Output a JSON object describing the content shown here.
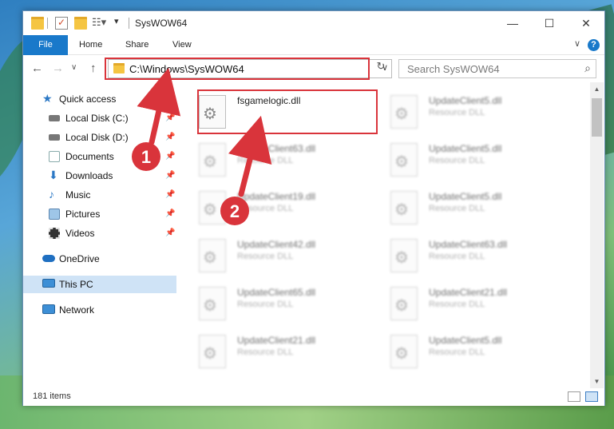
{
  "window": {
    "title": "SysWOW64",
    "minimize_glyph": "—",
    "maximize_glyph": "☐",
    "close_glyph": "✕"
  },
  "ribbon": {
    "tabs": [
      "File",
      "Home",
      "Share",
      "View"
    ],
    "help_glyph": "?",
    "collapse_glyph": "∨"
  },
  "nav": {
    "back_glyph": "←",
    "forward_glyph": "→",
    "recent_glyph": "∨",
    "up_glyph": "↑",
    "address": "C:\\Windows\\SysWOW64",
    "address_drop_glyph": "∨",
    "refresh_glyph": "↻",
    "search_placeholder": "Search SysWOW64",
    "search_glyph": "⌕"
  },
  "sidebar": {
    "items": [
      {
        "label": "Quick access",
        "icon": "star-icon",
        "pinned": false
      },
      {
        "label": "Local Disk (C:)",
        "icon": "drive-icon",
        "pinned": true
      },
      {
        "label": "Local Disk (D:)",
        "icon": "drive-icon",
        "pinned": true
      },
      {
        "label": "Documents",
        "icon": "documents-icon",
        "pinned": true
      },
      {
        "label": "Downloads",
        "icon": "download-icon",
        "pinned": true
      },
      {
        "label": "Music",
        "icon": "music-icon",
        "pinned": true
      },
      {
        "label": "Pictures",
        "icon": "pictures-icon",
        "pinned": true
      },
      {
        "label": "Videos",
        "icon": "videos-icon",
        "pinned": true
      },
      {
        "label": "OneDrive",
        "icon": "cloud-icon",
        "pinned": false
      },
      {
        "label": "This PC",
        "icon": "computer-icon",
        "pinned": false,
        "selected": true
      },
      {
        "label": "Network",
        "icon": "network-icon",
        "pinned": false
      }
    ],
    "pin_glyph": "📌"
  },
  "files": [
    {
      "name": "fsgamelogic.dll",
      "type": ""
    },
    {
      "name": "UpdateClient5.dll",
      "type": "Resource DLL"
    },
    {
      "name": "UpdateClient63.dll",
      "type": "Resource DLL"
    },
    {
      "name": "UpdateClient5.dll",
      "type": "Resource DLL"
    },
    {
      "name": "UpdateClient19.dll",
      "type": "Resource DLL"
    },
    {
      "name": "UpdateClient5.dll",
      "type": "Resource DLL"
    },
    {
      "name": "UpdateClient42.dll",
      "type": "Resource DLL"
    },
    {
      "name": "UpdateClient63.dll",
      "type": "Resource DLL"
    },
    {
      "name": "UpdateClient65.dll",
      "type": "Resource DLL"
    },
    {
      "name": "UpdateClient21.dll",
      "type": "Resource DLL"
    },
    {
      "name": "UpdateClient21.dll",
      "type": "Resource DLL"
    },
    {
      "name": "UpdateClient5.dll",
      "type": "Resource DLL"
    }
  ],
  "status": {
    "item_count": "181 items"
  },
  "annotations": {
    "step1": "1",
    "step2": "2",
    "color": "#d9343b"
  }
}
